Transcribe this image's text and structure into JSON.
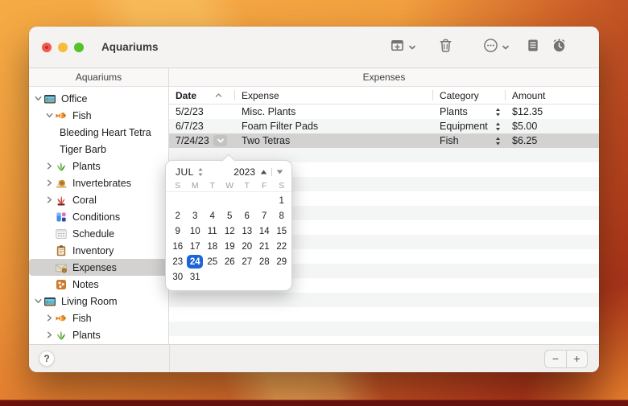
{
  "window": {
    "title": "Aquariums"
  },
  "toolbar": {
    "buttons": [
      {
        "name": "add-record",
        "icon": "add-record-icon",
        "has_dropdown": true
      },
      {
        "name": "delete-record",
        "icon": "trash-icon",
        "has_dropdown": false
      },
      {
        "name": "more-actions",
        "icon": "ellipsis-circle-icon",
        "has_dropdown": true
      },
      {
        "name": "form-view",
        "icon": "form-view-icon",
        "has_dropdown": false
      },
      {
        "name": "reminders",
        "icon": "alarm-clock-icon",
        "has_dropdown": false
      }
    ]
  },
  "sidebar": {
    "header": "Aquariums",
    "items": [
      {
        "label": "Office",
        "icon": "aquarium-icon",
        "level": 1,
        "chevron": "expanded"
      },
      {
        "label": "Fish",
        "icon": "fish-icon",
        "level": 2,
        "chevron": "expanded"
      },
      {
        "label": "Bleeding Heart Tetra",
        "level": 3
      },
      {
        "label": "Tiger Barb",
        "level": 3
      },
      {
        "label": "Plants",
        "icon": "plant-icon",
        "level": 2,
        "chevron": "collapsed"
      },
      {
        "label": "Invertebrates",
        "icon": "snail-icon",
        "level": 2,
        "chevron": "collapsed"
      },
      {
        "label": "Coral",
        "icon": "coral-icon",
        "level": 2,
        "chevron": "collapsed"
      },
      {
        "label": "Conditions",
        "icon": "conditions-icon",
        "level": 2
      },
      {
        "label": "Schedule",
        "icon": "calendar-icon",
        "level": 2
      },
      {
        "label": "Inventory",
        "icon": "clipboard-icon",
        "level": 2
      },
      {
        "label": "Expenses",
        "icon": "expenses-icon",
        "level": 2,
        "selected": true
      },
      {
        "label": "Notes",
        "icon": "notes-icon",
        "level": 2
      },
      {
        "label": "Living Room",
        "icon": "aquarium-icon",
        "level": 1,
        "chevron": "expanded"
      },
      {
        "label": "Fish",
        "icon": "fish-icon",
        "level": 2,
        "chevron": "collapsed"
      },
      {
        "label": "Plants",
        "icon": "plant-icon",
        "level": 2,
        "chevron": "collapsed"
      }
    ],
    "help_label": "?"
  },
  "main": {
    "header": "Expenses",
    "columns": [
      {
        "label": "Date",
        "sorted": "asc"
      },
      {
        "label": "Expense"
      },
      {
        "label": "Category"
      },
      {
        "label": "Amount"
      }
    ],
    "rows": [
      {
        "date": "5/2/23",
        "expense": "Misc. Plants",
        "category": "Plants",
        "amount": "$12.35"
      },
      {
        "date": "6/7/23",
        "expense": "Foam Filter Pads",
        "category": "Equipment",
        "amount": "$5.00"
      },
      {
        "date": "7/24/23",
        "expense": "Two Tetras",
        "category": "Fish",
        "amount": "$6.25",
        "selected": true,
        "date_picker_open": true
      }
    ]
  },
  "calendar": {
    "month": "JUL",
    "year": "2023",
    "day_letters": [
      "S",
      "M",
      "T",
      "W",
      "T",
      "F",
      "S"
    ],
    "weeks": [
      [
        null,
        null,
        null,
        null,
        null,
        null,
        1
      ],
      [
        2,
        3,
        4,
        5,
        6,
        7,
        8
      ],
      [
        9,
        10,
        11,
        12,
        13,
        14,
        15
      ],
      [
        16,
        17,
        18,
        19,
        20,
        21,
        22
      ],
      [
        23,
        24,
        25,
        26,
        27,
        28,
        29
      ],
      [
        30,
        31,
        null,
        null,
        null,
        null,
        null
      ]
    ],
    "selected_day": 24
  },
  "footer": {
    "zoom_out": "−",
    "zoom_in": "+"
  },
  "colors": {
    "accent": "#1b65d9",
    "selection_gray": "#d3d2d1",
    "row_stripe": "#f4f5f5",
    "titlebar_bg": "#f4f3f1",
    "wallpaper_top": "#f6ab45",
    "wallpaper_bottom": "#b8401e",
    "wallpaper_strip": "#6d1310"
  }
}
